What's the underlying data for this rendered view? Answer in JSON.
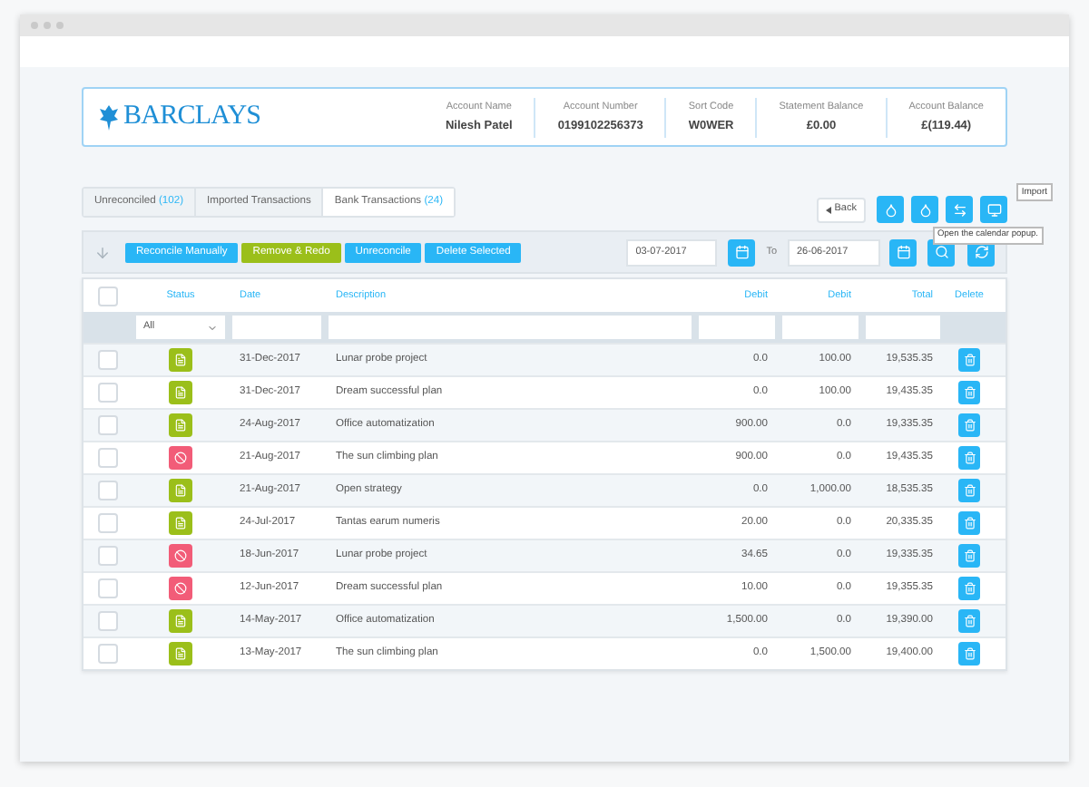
{
  "account": {
    "bank": "BARCLAYS",
    "fields": [
      {
        "label": "Account Name",
        "value": "Nilesh Patel"
      },
      {
        "label": "Account Number",
        "value": "0199102256373"
      },
      {
        "label": "Sort Code",
        "value": "W0WER"
      },
      {
        "label": "Statement Balance",
        "value": "£0.00"
      },
      {
        "label": "Account Balance",
        "value": "£(119.44)"
      }
    ]
  },
  "tabs": [
    {
      "label": "Unreconciled",
      "count": "(102)",
      "selected": false
    },
    {
      "label": "Imported Transactions",
      "selected": false
    },
    {
      "label": "Bank Transactions",
      "count": "(24)",
      "selected": true
    }
  ],
  "back_button": "Back",
  "tooltips": {
    "import": "Import",
    "calendar": "Open the calendar popup."
  },
  "actions": [
    {
      "label": "Reconcile Manually",
      "kind": "primary"
    },
    {
      "label": "Remove & Redo",
      "kind": "secondary"
    },
    {
      "label": "Unreconcile",
      "kind": "primary"
    },
    {
      "label": "Delete Selected",
      "kind": "primary"
    }
  ],
  "date_range": {
    "from": "03-07-2017",
    "to_label": "To",
    "to": "26-06-2017"
  },
  "table": {
    "select_all_checked": false,
    "columns": [
      "Status",
      "Date",
      "Description",
      "Debit",
      "Debit",
      "Total",
      "Delete"
    ],
    "status_filter": "All",
    "rows": [
      {
        "checked": false,
        "kind": "ok",
        "date": "31-Dec-2017",
        "description": "Lunar probe project",
        "debit_1": "0.0",
        "debit_2": "100.00",
        "total": "19,535.35"
      },
      {
        "checked": false,
        "kind": "ok",
        "date": "31-Dec-2017",
        "description": "Dream successful plan",
        "debit_1": "0.0",
        "debit_2": "100.00",
        "total": "19,435.35"
      },
      {
        "checked": false,
        "kind": "ok",
        "date": "24-Aug-2017",
        "description": "Office automatization",
        "debit_1": "900.00",
        "debit_2": "0.0",
        "total": "19,335.35"
      },
      {
        "checked": false,
        "kind": "blocked",
        "date": "21-Aug-2017",
        "description": "The sun climbing plan",
        "debit_1": "900.00",
        "debit_2": "0.0",
        "total": "19,435.35"
      },
      {
        "checked": false,
        "kind": "ok",
        "date": "21-Aug-2017",
        "description": "Open strategy",
        "debit_1": "0.0",
        "debit_2": "1,000.00",
        "total": "18,535.35"
      },
      {
        "checked": false,
        "kind": "ok",
        "date": "24-Jul-2017",
        "description": "Tantas earum numeris",
        "debit_1": "20.00",
        "debit_2": "0.0",
        "total": "20,335.35"
      },
      {
        "checked": false,
        "kind": "blocked",
        "date": "18-Jun-2017",
        "description": "Lunar probe project",
        "debit_1": "34.65",
        "debit_2": "0.0",
        "total": "19,335.35"
      },
      {
        "checked": false,
        "kind": "blocked",
        "date": "12-Jun-2017",
        "description": "Dream successful plan",
        "debit_1": "10.00",
        "debit_2": "0.0",
        "total": "19,355.35"
      },
      {
        "checked": false,
        "kind": "ok",
        "date": "14-May-2017",
        "description": "Office automatization",
        "debit_1": "1,500.00",
        "debit_2": "0.0",
        "total": "19,390.00"
      },
      {
        "checked": false,
        "kind": "ok",
        "date": "13-May-2017",
        "description": "The sun climbing plan",
        "debit_1": "0.0",
        "debit_2": "1,500.00",
        "total": "19,400.00"
      }
    ]
  }
}
